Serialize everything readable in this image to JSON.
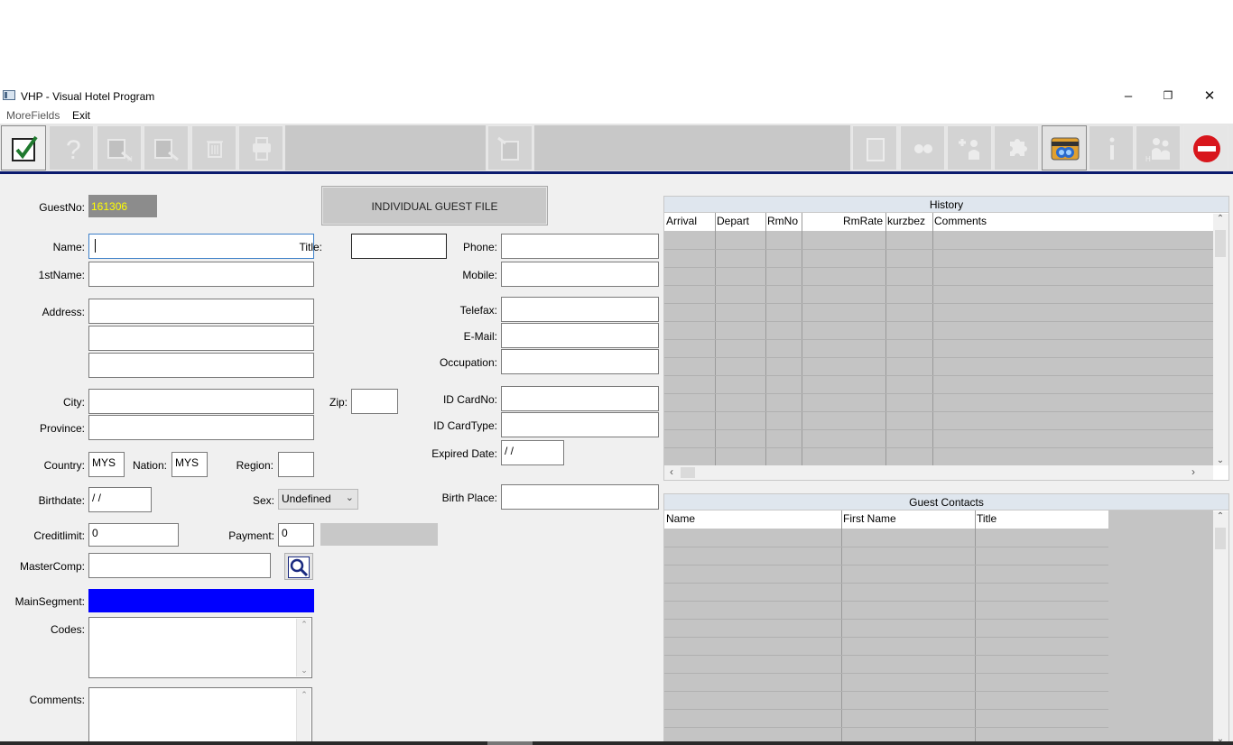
{
  "window": {
    "title": "VHP - Visual Hotel Program"
  },
  "menu": {
    "morefields": "MoreFields",
    "exit": "Exit"
  },
  "form": {
    "guestno_label": "GuestNo:",
    "guestno_value": "161306",
    "header_button": "INDIVIDUAL GUEST FILE",
    "name_label": "Name:",
    "name_value": "",
    "title_label": "Title:",
    "title_value": "",
    "phone_label": "Phone:",
    "phone_value": "",
    "firstname_label": "1stName:",
    "firstname_value": "",
    "mobile_label": "Mobile:",
    "mobile_value": "",
    "address_label": "Address:",
    "address1": "",
    "address2": "",
    "address3": "",
    "telefax_label": "Telefax:",
    "telefax_value": "",
    "email_label": "E-Mail:",
    "email_value": "",
    "occupation_label": "Occupation:",
    "occupation_value": "",
    "city_label": "City:",
    "city_value": "",
    "zip_label": "Zip:",
    "zip_value": "",
    "idcardno_label": "ID CardNo:",
    "idcardno_value": "",
    "province_label": "Province:",
    "province_value": "",
    "idcardtype_label": "ID CardType:",
    "idcardtype_value": "",
    "country_label": "Country:",
    "country_value": "MYS",
    "nation_label": "Nation:",
    "nation_value": "MYS",
    "region_label": "Region:",
    "region_value": "",
    "expired_label": "Expired Date:",
    "expired_value": " /  /",
    "birthdate_label": "Birthdate:",
    "birthdate_value": " /  /",
    "sex_label": "Sex:",
    "sex_value": "Undefined",
    "birthplace_label": "Birth Place:",
    "birthplace_value": "",
    "creditlimit_label": "Creditlimit:",
    "creditlimit_value": "0",
    "payment_label": "Payment:",
    "payment_value": "0",
    "mastercomp_label": "MasterComp:",
    "mastercomp_value": "",
    "mainsegment_label": "MainSegment:",
    "codes_label": "Codes:",
    "comments_label": "Comments:"
  },
  "history": {
    "caption": "History",
    "columns": [
      "Arrival",
      "Depart",
      "RmNo",
      "RmRate",
      "kurzbez",
      "Comments"
    ]
  },
  "contacts": {
    "caption": "Guest Contacts",
    "columns": [
      "Name",
      "First Name",
      "Title"
    ]
  },
  "colors": {
    "guestno_bg": "#8c8c8c",
    "guestno_text": "#ffff00",
    "mainsegment_bg": "#0000ff",
    "toolbar_underline": "#0a1a6e",
    "exit_icon": "#d8161c"
  },
  "icons": [
    "checkmark-icon",
    "help-icon",
    "new-icon",
    "search-icon",
    "trash-icon",
    "print-icon",
    "document-icon",
    "page-icon",
    "binoculars-icon",
    "add-guest-icon",
    "puzzle-icon",
    "membership-card-icon",
    "info-icon",
    "guest-history-icon",
    "exit-icon"
  ]
}
